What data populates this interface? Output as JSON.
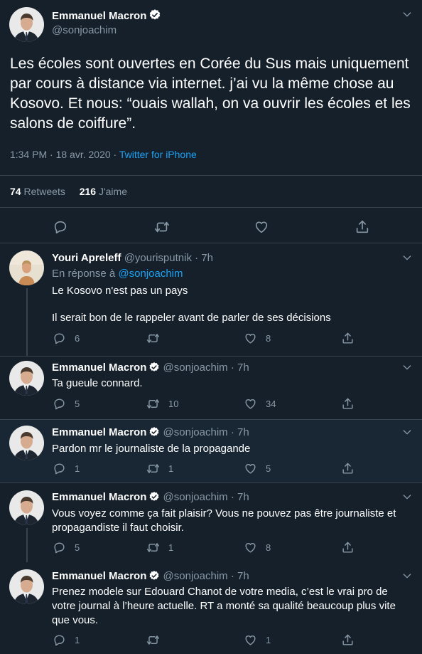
{
  "main_tweet": {
    "author_name": "Emmanuel Macron",
    "handle": "@sonjoachim",
    "text": "Les écoles sont ouvertes en Corée du Sus mais uniquement par cours à distance via internet. j’ai vu la même chose au Kosovo. Et nous: “ouais wallah, on va ouvrir les écoles et les salons de coiffure”.",
    "timestamp": "1:34 PM · 18 avr. 2020 · ",
    "source": "Twitter for iPhone",
    "retweets_count": "74",
    "retweets_label": "Retweets",
    "likes_count": "216",
    "likes_label": "J'aime"
  },
  "replies": [
    {
      "author_name": "Youri Apreleff",
      "handle_time": "@yourisputnik · 7h",
      "in_reply_prefix": "En réponse à ",
      "in_reply_handle": "@sonjoachim",
      "text_line1": "Le Kosovo n'est pas un pays",
      "text_line2": "Il serait bon de le rappeler avant de parler de ses décisions",
      "reply_count": "6",
      "retweet_count": "",
      "like_count": "8"
    },
    {
      "author_name": "Emmanuel Macron",
      "handle_time": "@sonjoachim · 7h",
      "text": "Ta gueule connard.",
      "reply_count": "5",
      "retweet_count": "10",
      "like_count": "34"
    },
    {
      "author_name": "Emmanuel Macron",
      "handle_time": "@sonjoachim · 7h",
      "text": "Pardon mr le journaliste de la propagande",
      "reply_count": "1",
      "retweet_count": "1",
      "like_count": "5"
    },
    {
      "author_name": "Emmanuel Macron",
      "handle_time": "@sonjoachim · 7h",
      "text": "Vous voyez comme ça fait plaisir? Vous ne pouvez pas être journaliste et propagandiste il faut choisir.",
      "reply_count": "5",
      "retweet_count": "1",
      "like_count": "8"
    },
    {
      "author_name": "Emmanuel Macron",
      "handle_time": "@sonjoachim · 7h",
      "text": "Prenez modele sur Edouard Chanot de votre media, c’est le vrai pro de votre journal à l’heure actuelle. RT a monté sa qualité beaucoup plus vite que vous.",
      "reply_count": "1",
      "retweet_count": "",
      "like_count": "1"
    }
  ],
  "colors": {
    "background": "#15202b",
    "highlight_background": "#192734",
    "secondary_text": "#8899a6",
    "link": "#1da1f2",
    "separator": "#38444d"
  },
  "icons": [
    "verified-badge-icon",
    "chevron-down-icon",
    "reply-icon",
    "retweet-icon",
    "like-icon",
    "share-icon"
  ]
}
